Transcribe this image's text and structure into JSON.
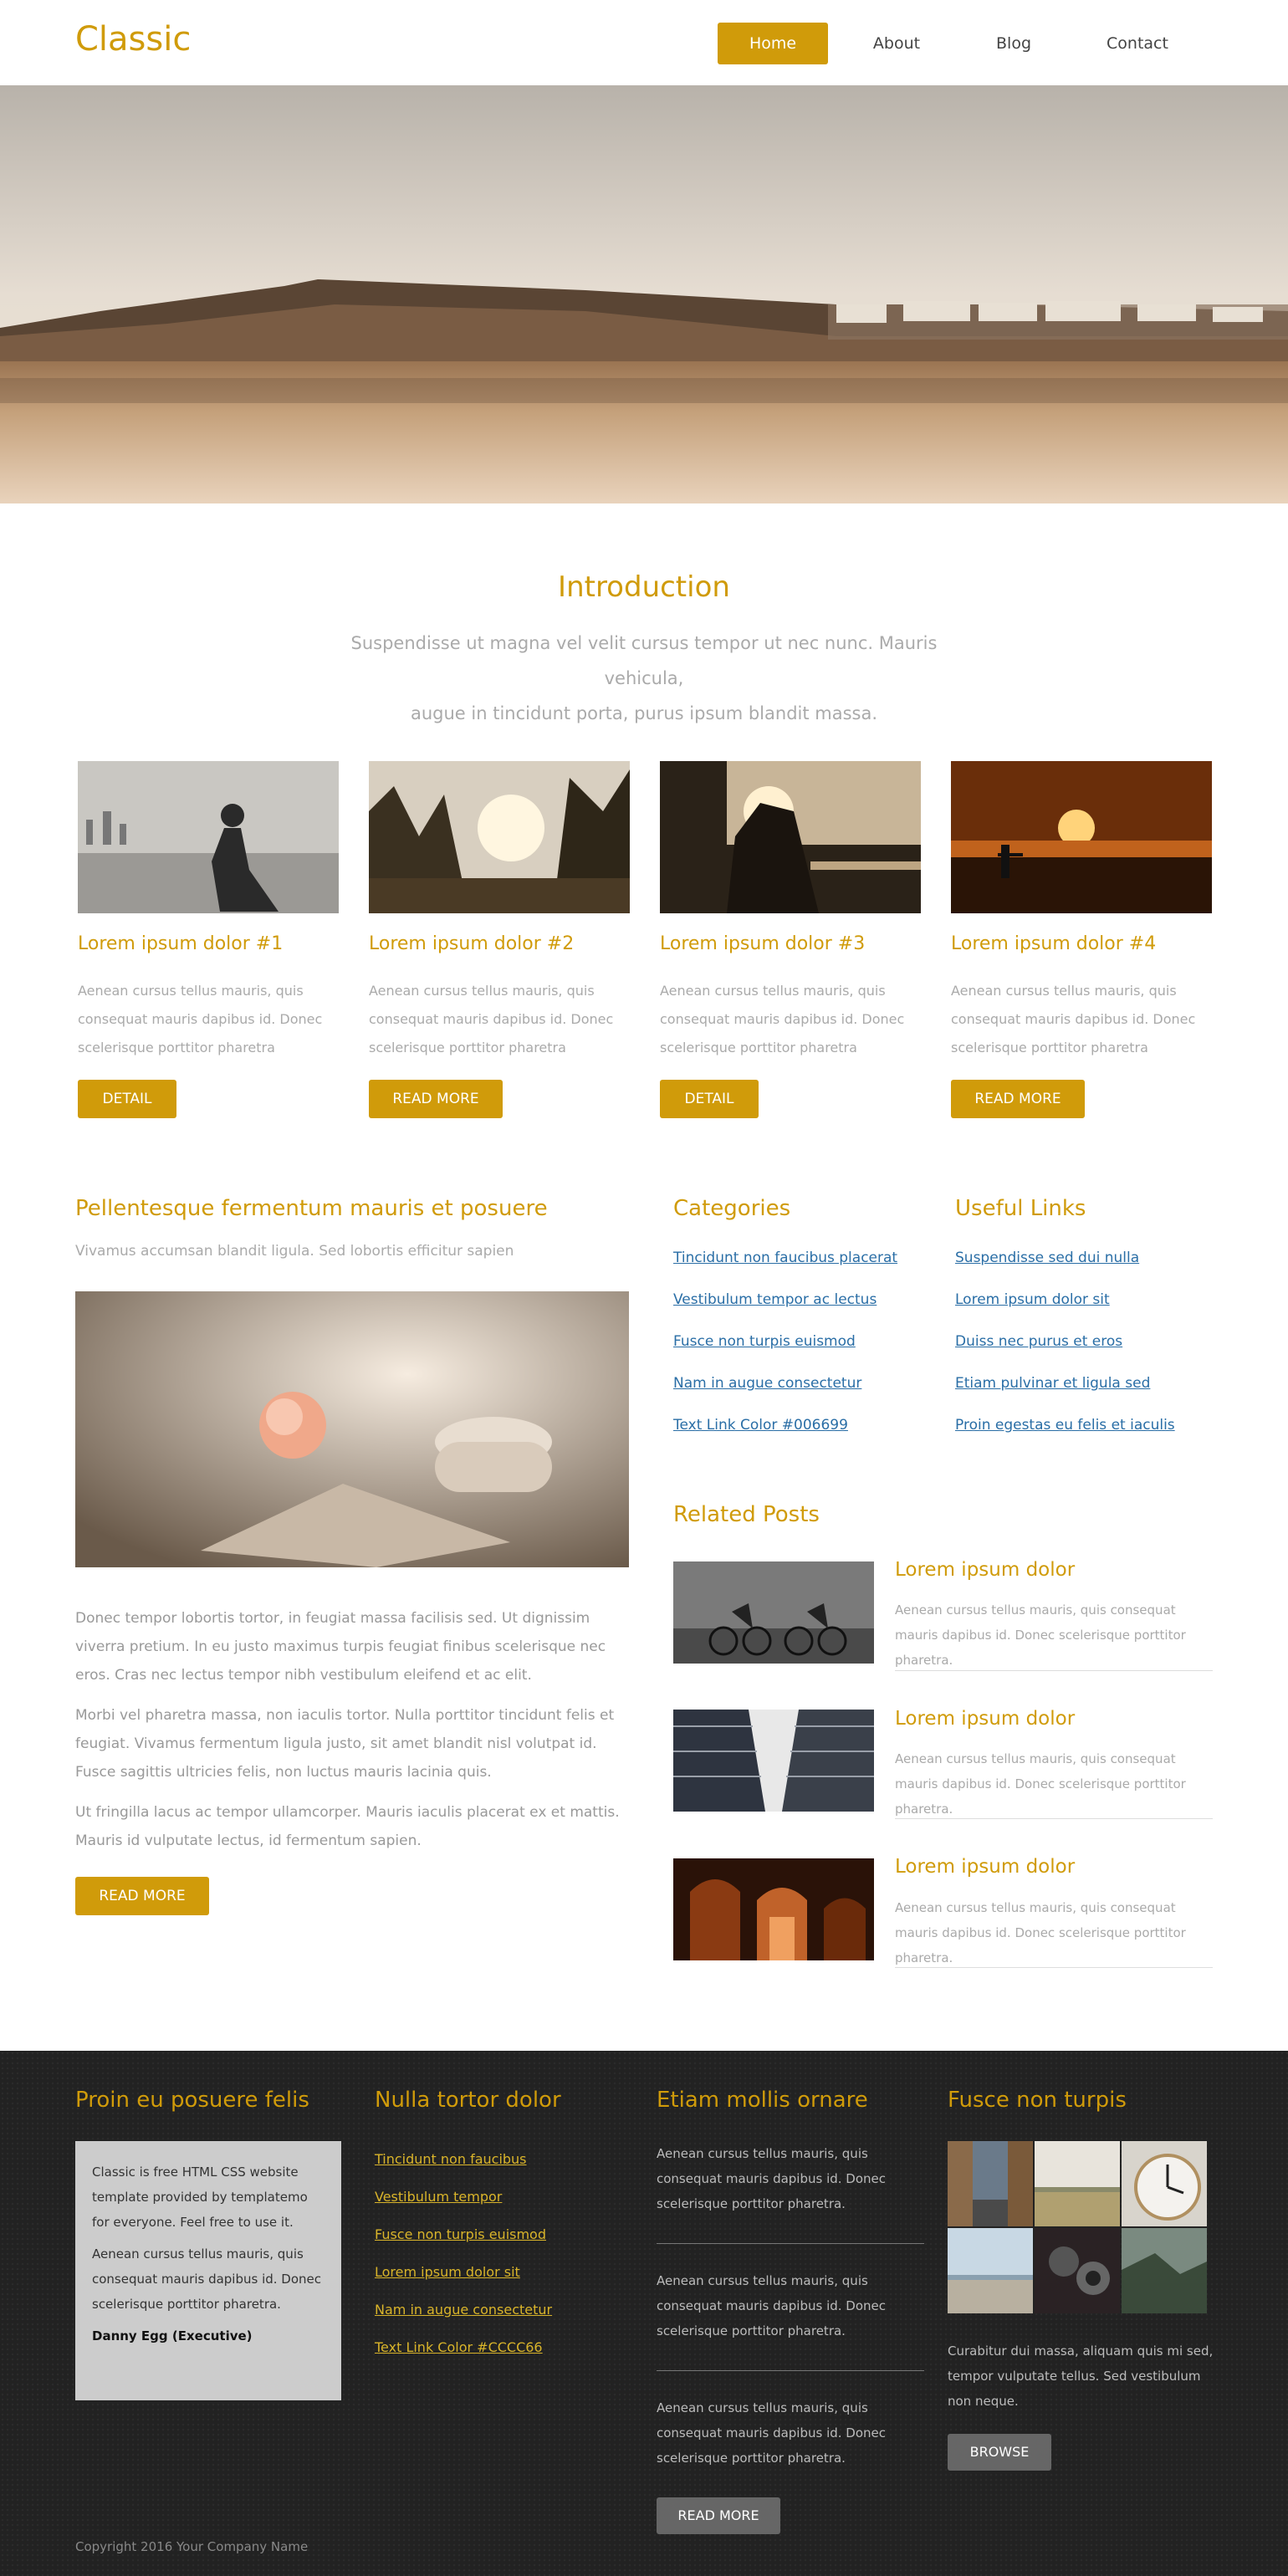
{
  "header": {
    "logo": "Classic",
    "nav": [
      "Home",
      "About",
      "Blog",
      "Contact"
    ]
  },
  "intro": {
    "title": "Introduction",
    "text_line1": "Suspendisse ut magna vel velit cursus tempor ut nec nunc. Mauris vehicula,",
    "text_line2": "augue in tincidunt porta, purus ipsum blandit massa."
  },
  "cards": [
    {
      "title": "Lorem ipsum dolor #1",
      "text": "Aenean cursus tellus mauris, quis consequat mauris dapibus id. Donec scelerisque porttitor pharetra",
      "button": "DETAIL"
    },
    {
      "title": "Lorem ipsum dolor #2",
      "text": "Aenean cursus tellus mauris, quis consequat mauris dapibus id. Donec scelerisque porttitor pharetra",
      "button": "READ MORE"
    },
    {
      "title": "Lorem ipsum dolor #3",
      "text": "Aenean cursus tellus mauris, quis consequat mauris dapibus id. Donec scelerisque porttitor pharetra",
      "button": "DETAIL"
    },
    {
      "title": "Lorem ipsum dolor #4",
      "text": "Aenean cursus tellus mauris, quis consequat mauris dapibus id. Donec scelerisque porttitor pharetra",
      "button": "READ MORE"
    }
  ],
  "article": {
    "title": "Pellentesque fermentum mauris et posuere",
    "subtitle": "Vivamus accumsan blandit ligula. Sed lobortis efficitur sapien",
    "p1": "Donec tempor lobortis tortor, in feugiat massa facilisis sed. Ut dignissim viverra pretium. In eu justo maximus turpis feugiat finibus scelerisque nec eros. Cras nec lectus tempor nibh vestibulum eleifend et ac elit.",
    "p2": "Morbi vel pharetra massa, non iaculis tortor. Nulla porttitor tincidunt felis et feugiat. Vivamus fermentum ligula justo, sit amet blandit nisl volutpat id. Fusce sagittis ultricies felis, non luctus mauris lacinia quis.",
    "p3": "Ut fringilla lacus ac tempor ullamcorper. Mauris iaculis placerat ex et mattis. Mauris id vulputate lectus, id fermentum sapien.",
    "button": "READ MORE"
  },
  "categories": {
    "title": "Categories",
    "links": [
      "Tincidunt non faucibus placerat",
      "Vestibulum tempor ac lectus",
      "Fusce non turpis euismod",
      "Nam in augue consectetur",
      "Text Link Color #006699"
    ]
  },
  "useful_links": {
    "title": "Useful Links",
    "links": [
      "Suspendisse sed dui nulla",
      "Lorem ipsum dolor sit",
      "Duiss nec purus et eros",
      "Etiam pulvinar et ligula sed",
      "Proin egestas eu felis et iaculis"
    ]
  },
  "related": {
    "title": "Related Posts",
    "posts": [
      {
        "title": "Lorem ipsum dolor",
        "text": "Aenean cursus tellus mauris, quis consequat mauris dapibus id. Donec scelerisque porttitor pharetra."
      },
      {
        "title": "Lorem ipsum dolor",
        "text": "Aenean cursus tellus mauris, quis consequat mauris dapibus id. Donec scelerisque porttitor pharetra."
      },
      {
        "title": "Lorem ipsum dolor",
        "text": "Aenean cursus tellus mauris, quis consequat mauris dapibus id. Donec scelerisque porttitor pharetra."
      }
    ]
  },
  "footer": {
    "col1": {
      "title": "Proin eu posuere felis",
      "p1": "Classic is free HTML CSS website template provided by templatemo for everyone. Feel free to use it.",
      "p2": "Aenean cursus tellus mauris, quis consequat mauris dapibus id. Donec scelerisque porttitor pharetra.",
      "author": "Danny Egg (Executive)"
    },
    "col2": {
      "title": "Nulla tortor dolor",
      "links": [
        "Tincidunt non faucibus",
        "Vestibulum tempor",
        "Fusce non turpis euismod",
        "Lorem ipsum dolor sit",
        "Nam in augue consectetur",
        "Text Link Color #CCCC66"
      ]
    },
    "col3": {
      "title": "Etiam mollis ornare",
      "items": [
        "Aenean cursus tellus mauris, quis consequat mauris dapibus id. Donec scelerisque porttitor pharetra.",
        "Aenean cursus tellus mauris, quis consequat mauris dapibus id. Donec scelerisque porttitor pharetra.",
        "Aenean cursus tellus mauris, quis consequat mauris dapibus id. Donec scelerisque porttitor pharetra."
      ],
      "button": "READ MORE"
    },
    "col4": {
      "title": "Fusce non turpis",
      "text": "Curabitur dui massa, aliquam quis mi sed, tempor vulputate tellus. Sed vestibulum non neque.",
      "button": "BROWSE"
    },
    "copyright": "Copyright 2016 Your Company Name"
  },
  "colors": {
    "accent": "#d09b0a",
    "link": "#2a6ea6",
    "footer_bg": "#222222"
  }
}
